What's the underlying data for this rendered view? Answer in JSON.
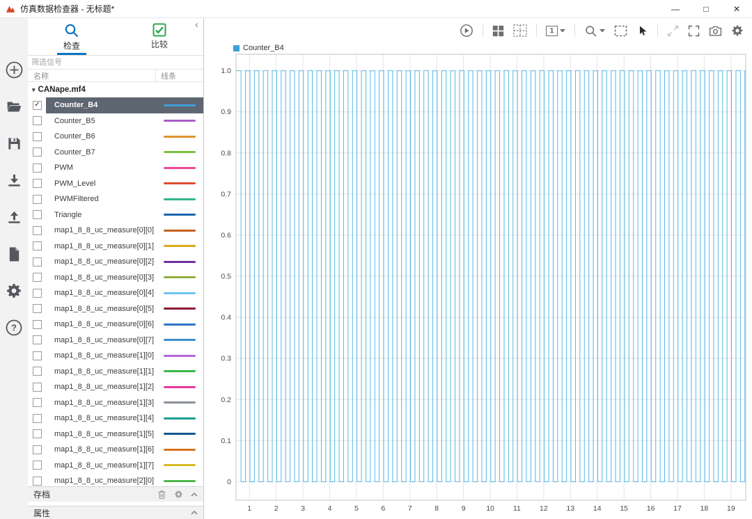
{
  "window": {
    "title": "仿真数据检查器 - 无标题*",
    "minimize_glyph": "—",
    "maximize_glyph": "□",
    "close_glyph": "✕"
  },
  "left_toolbar": {
    "icons": [
      "add-circle-icon",
      "open-folder-icon",
      "save-icon",
      "import-icon",
      "export-icon",
      "report-icon",
      "preferences-gear-icon",
      "help-icon"
    ]
  },
  "sidebar": {
    "collapse_glyph": "‹",
    "tabs": [
      {
        "label": "检查",
        "active": true
      },
      {
        "label": "比较",
        "active": false
      }
    ],
    "filter_placeholder": "筛选信号",
    "columns": {
      "name": "名称",
      "line": "线条"
    },
    "group": {
      "label": "CANape.mf4",
      "expand_glyph": "▾"
    },
    "signals": [
      {
        "name": "Counter_B4",
        "checked": true,
        "selected": true,
        "color": "#3d9fd8"
      },
      {
        "name": "Counter_B5",
        "checked": false,
        "selected": false,
        "color": "#a85cc7"
      },
      {
        "name": "Counter_B6",
        "checked": false,
        "selected": false,
        "color": "#e0912b"
      },
      {
        "name": "Counter_B7",
        "checked": false,
        "selected": false,
        "color": "#7cbf3f"
      },
      {
        "name": "PWM",
        "checked": false,
        "selected": false,
        "color": "#e8489a"
      },
      {
        "name": "PWM_Level",
        "checked": false,
        "selected": false,
        "color": "#e04a33"
      },
      {
        "name": "PWMFiltered",
        "checked": false,
        "selected": false,
        "color": "#33b58a"
      },
      {
        "name": "Triangle",
        "checked": false,
        "selected": false,
        "color": "#1465ab"
      },
      {
        "name": "map1_8_8_uc_measure[0][0]",
        "checked": false,
        "selected": false,
        "color": "#c2601e"
      },
      {
        "name": "map1_8_8_uc_measure[0][1]",
        "checked": false,
        "selected": false,
        "color": "#d9a91f"
      },
      {
        "name": "map1_8_8_uc_measure[0][2]",
        "checked": false,
        "selected": false,
        "color": "#7030a0"
      },
      {
        "name": "map1_8_8_uc_measure[0][3]",
        "checked": false,
        "selected": false,
        "color": "#8faf3a"
      },
      {
        "name": "map1_8_8_uc_measure[0][4]",
        "checked": false,
        "selected": false,
        "color": "#6cc5ef"
      },
      {
        "name": "map1_8_8_uc_measure[0][5]",
        "checked": false,
        "selected": false,
        "color": "#8c1a2f"
      },
      {
        "name": "map1_8_8_uc_measure[0][6]",
        "checked": false,
        "selected": false,
        "color": "#2e75c6"
      },
      {
        "name": "map1_8_8_uc_measure[0][7]",
        "checked": false,
        "selected": false,
        "color": "#3a8fd0"
      },
      {
        "name": "map1_8_8_uc_measure[1][0]",
        "checked": false,
        "selected": false,
        "color": "#b565d9"
      },
      {
        "name": "map1_8_8_uc_measure[1][1]",
        "checked": false,
        "selected": false,
        "color": "#3cb54a"
      },
      {
        "name": "map1_8_8_uc_measure[1][2]",
        "checked": false,
        "selected": false,
        "color": "#e83a9e"
      },
      {
        "name": "map1_8_8_uc_measure[1][3]",
        "checked": false,
        "selected": false,
        "color": "#8a9299"
      },
      {
        "name": "map1_8_8_uc_measure[1][4]",
        "checked": false,
        "selected": false,
        "color": "#199e8c"
      },
      {
        "name": "map1_8_8_uc_measure[1][5]",
        "checked": false,
        "selected": false,
        "color": "#14558c"
      },
      {
        "name": "map1_8_8_uc_measure[1][6]",
        "checked": false,
        "selected": false,
        "color": "#d9731f"
      },
      {
        "name": "map1_8_8_uc_measure[1][7]",
        "checked": false,
        "selected": false,
        "color": "#d9b81f"
      },
      {
        "name": "map1_8_8_uc_measure[2][0]",
        "checked": false,
        "selected": false,
        "color": "#4cb84c"
      }
    ],
    "archive": {
      "label": "存档",
      "icons": [
        "trash-icon",
        "gear-icon",
        "collapse-up-icon"
      ]
    },
    "properties": {
      "label": "属性",
      "icons": [
        "collapse-up-icon"
      ]
    }
  },
  "plot_toolbar": {
    "view_count_label": "1",
    "icons": [
      "play-circle-icon",
      "layout-grid-icon",
      "subplot-grid-icon",
      "view-layout-dropdown",
      "zoom-icon",
      "fit-to-view-icon",
      "pointer-icon",
      "expand-diagonal-icon",
      "fullscreen-icon",
      "camera-icon",
      "settings-gear-icon"
    ]
  },
  "chart_data": {
    "type": "line",
    "title": "",
    "xlabel": "",
    "ylabel": "",
    "legend": [
      {
        "label": "Counter_B4",
        "color": "#3d9fd8",
        "position": "top-left"
      }
    ],
    "series": [
      {
        "name": "Counter_B4",
        "color": "#56b8e6",
        "waveform": "square",
        "y_low": 0,
        "y_high": 1,
        "period": 0.3333,
        "duty_cycle": 0.5,
        "x_start": 0.52,
        "x_end": 19.55
      }
    ],
    "xlim": [
      0.5,
      19.55
    ],
    "ylim": [
      -0.045,
      1.04
    ],
    "x_ticks": [
      1,
      2,
      3,
      4,
      5,
      6,
      7,
      8,
      9,
      10,
      11,
      12,
      13,
      14,
      15,
      16,
      17,
      18,
      19
    ],
    "y_ticks": [
      0,
      0.1,
      0.2,
      0.3,
      0.4,
      0.5,
      0.6,
      0.7,
      0.8,
      0.9,
      1.0
    ],
    "y_tick_labels": [
      "0",
      "0.1",
      "0.2",
      "0.3",
      "0.4",
      "0.5",
      "0.6",
      "0.7",
      "0.8",
      "0.9",
      "1.0"
    ],
    "grid": true
  }
}
